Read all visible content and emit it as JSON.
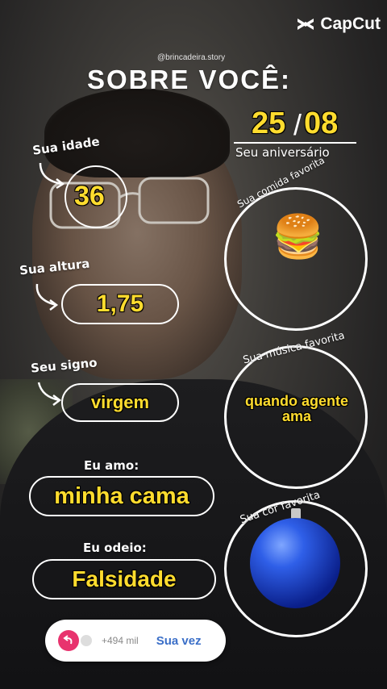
{
  "app": {
    "logo_text": "CapCut"
  },
  "header": {
    "handle": "@brincadeira.story",
    "title": "SOBRE VOCÊ:"
  },
  "birthday": {
    "day": "25",
    "month": "08",
    "separator": "/",
    "label": "Seu aniversário"
  },
  "age": {
    "label": "Sua idade",
    "value": "36"
  },
  "height": {
    "label": "Sua altura",
    "value": "1,75"
  },
  "sign": {
    "label": "Seu signo",
    "value": "virgem"
  },
  "love": {
    "label": "Eu amo:",
    "value": "minha cama"
  },
  "hate": {
    "label": "Eu odeio:",
    "value": "Falsidade"
  },
  "food": {
    "label": "Sua comida favorita",
    "icon": "hamburger-icon",
    "emoji": "🍔"
  },
  "music": {
    "label": "Sua música favorita",
    "value": "quando agente ama"
  },
  "color": {
    "label": "Sua cor favorita",
    "icon": "blue-ornament-icon",
    "hex": "#1e4fd8"
  },
  "footer": {
    "count": "+494 mil",
    "action": "Sua vez"
  },
  "colors": {
    "accent_yellow": "#ffdc2e",
    "brand_pink": "#e8336e",
    "link_blue": "#3b6fc8"
  }
}
